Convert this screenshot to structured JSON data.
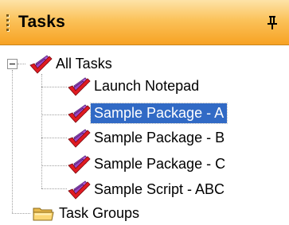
{
  "panel": {
    "title": "Tasks",
    "pin_icon": "pushpin-icon",
    "colors": {
      "header_top": "#fde3a8",
      "header_bottom": "#f7a223",
      "selection": "#316ac5"
    }
  },
  "tree": {
    "root": {
      "label": "All Tasks",
      "icon": "tasks-checkmark-icon",
      "expanded": true
    },
    "tasks": [
      {
        "label": "Launch Notepad",
        "icon": "task-checkmark-icon",
        "selected": false
      },
      {
        "label": "Sample Package - A",
        "icon": "task-checkmark-icon",
        "selected": true
      },
      {
        "label": "Sample Package - B",
        "icon": "task-checkmark-icon",
        "selected": false
      },
      {
        "label": "Sample Package - C",
        "icon": "task-checkmark-icon",
        "selected": false
      },
      {
        "label": "Sample Script - ABC",
        "icon": "task-checkmark-icon",
        "selected": false
      }
    ],
    "groups": {
      "label": "Task Groups",
      "icon": "folder-icon"
    }
  }
}
